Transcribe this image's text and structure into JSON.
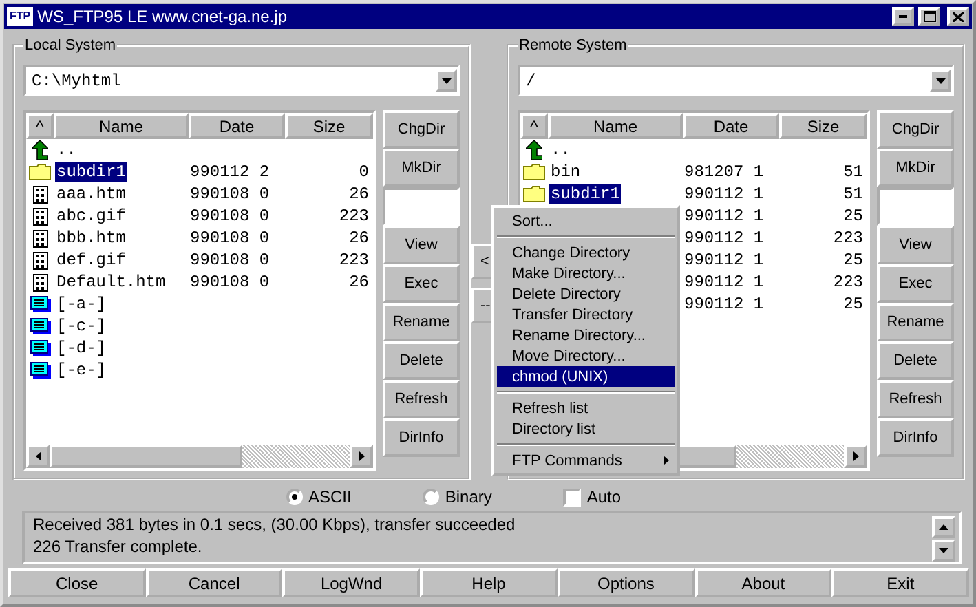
{
  "window": {
    "icon_text": "FTP",
    "title": "WS_FTP95 LE www.cnet-ga.ne.jp"
  },
  "local": {
    "title": "Local System",
    "path": "C:\\Myhtml",
    "columns": [
      "^",
      "Name",
      "Date",
      "Size"
    ],
    "rows": [
      {
        "kind": "up",
        "name": "..",
        "selected": false
      },
      {
        "kind": "folder",
        "name": "subdir1",
        "date": "990112 2",
        "size": "0",
        "selected": true
      },
      {
        "kind": "file",
        "name": "aaa.htm",
        "date": "990108 0",
        "size": "26",
        "selected": false
      },
      {
        "kind": "file",
        "name": "abc.gif",
        "date": "990108 0",
        "size": "223",
        "selected": false
      },
      {
        "kind": "file",
        "name": "bbb.htm",
        "date": "990108 0",
        "size": "26",
        "selected": false
      },
      {
        "kind": "file",
        "name": "def.gif",
        "date": "990108 0",
        "size": "223",
        "selected": false
      },
      {
        "kind": "file",
        "name": "Default.htm",
        "date": "990108 0",
        "size": "26",
        "selected": false
      },
      {
        "kind": "drive",
        "name": "[-a-]",
        "selected": false
      },
      {
        "kind": "drive",
        "name": "[-c-]",
        "selected": false
      },
      {
        "kind": "drive",
        "name": "[-d-]",
        "selected": false
      },
      {
        "kind": "drive",
        "name": "[-e-]",
        "selected": false
      }
    ],
    "buttons": [
      {
        "kind": "button",
        "label": "ChgDir"
      },
      {
        "kind": "button",
        "label": "MkDir"
      },
      {
        "kind": "field"
      },
      {
        "kind": "button",
        "label": "View"
      },
      {
        "kind": "button",
        "label": "Exec"
      },
      {
        "kind": "button",
        "label": "Rename"
      },
      {
        "kind": "button",
        "label": "Delete"
      },
      {
        "kind": "button",
        "label": "Refresh"
      },
      {
        "kind": "button",
        "label": "DirInfo"
      }
    ]
  },
  "transfer_buttons": [
    "<",
    "--"
  ],
  "remote": {
    "title": "Remote System",
    "path": "/",
    "columns": [
      "^",
      "Name",
      "Date",
      "Size"
    ],
    "rows": [
      {
        "kind": "up",
        "name": "..",
        "selected": false
      },
      {
        "kind": "folder",
        "name": "bin",
        "date": "981207 1",
        "size": "51",
        "selected": false
      },
      {
        "kind": "folder",
        "name": "subdir1",
        "date": "990112 1",
        "size": "51",
        "selected": true
      },
      {
        "date": "990112 1",
        "size": "25",
        "selected": false
      },
      {
        "date": "990112 1",
        "size": "223",
        "selected": false
      },
      {
        "date": "990112 1",
        "size": "25",
        "selected": false
      },
      {
        "date": "990112 1",
        "size": "223",
        "selected": false
      },
      {
        "date": "990112 1",
        "size": "25",
        "selected": false
      }
    ],
    "buttons": [
      {
        "kind": "button",
        "label": "ChgDir"
      },
      {
        "kind": "button",
        "label": "MkDir"
      },
      {
        "kind": "field"
      },
      {
        "kind": "button",
        "label": "View"
      },
      {
        "kind": "button",
        "label": "Exec"
      },
      {
        "kind": "button",
        "label": "Rename"
      },
      {
        "kind": "button",
        "label": "Delete"
      },
      {
        "kind": "button",
        "label": "Refresh"
      },
      {
        "kind": "button",
        "label": "DirInfo"
      }
    ]
  },
  "context_menu": [
    {
      "kind": "item",
      "label": "Sort...",
      "selected": false
    },
    {
      "kind": "separator"
    },
    {
      "kind": "item",
      "label": "Change Directory",
      "selected": false
    },
    {
      "kind": "item",
      "label": "Make Directory...",
      "selected": false
    },
    {
      "kind": "item",
      "label": "Delete Directory",
      "selected": false
    },
    {
      "kind": "item",
      "label": "Transfer Directory",
      "selected": false
    },
    {
      "kind": "item",
      "label": "Rename Directory...",
      "selected": false
    },
    {
      "kind": "item",
      "label": "Move Directory...",
      "selected": false
    },
    {
      "kind": "item",
      "label": "chmod (UNIX)",
      "selected": true
    },
    {
      "kind": "separator"
    },
    {
      "kind": "item",
      "label": "Refresh list",
      "selected": false
    },
    {
      "kind": "item",
      "label": "Directory list",
      "selected": false
    },
    {
      "kind": "separator"
    },
    {
      "kind": "submenu",
      "label": "FTP Commands",
      "selected": false
    }
  ],
  "transfer_mode": [
    {
      "kind": "radio",
      "label": "ASCII",
      "selected": true
    },
    {
      "kind": "radio",
      "label": "Binary",
      "selected": false
    },
    {
      "kind": "checkbox",
      "label": "Auto",
      "checked": false
    }
  ],
  "log": [
    "Received 381 bytes in 0.1 secs, (30.00 Kbps), transfer succeeded",
    "226 Transfer complete."
  ],
  "bottom_buttons": [
    "Close",
    "Cancel",
    "LogWnd",
    "Help",
    "Options",
    "About",
    "Exit"
  ]
}
